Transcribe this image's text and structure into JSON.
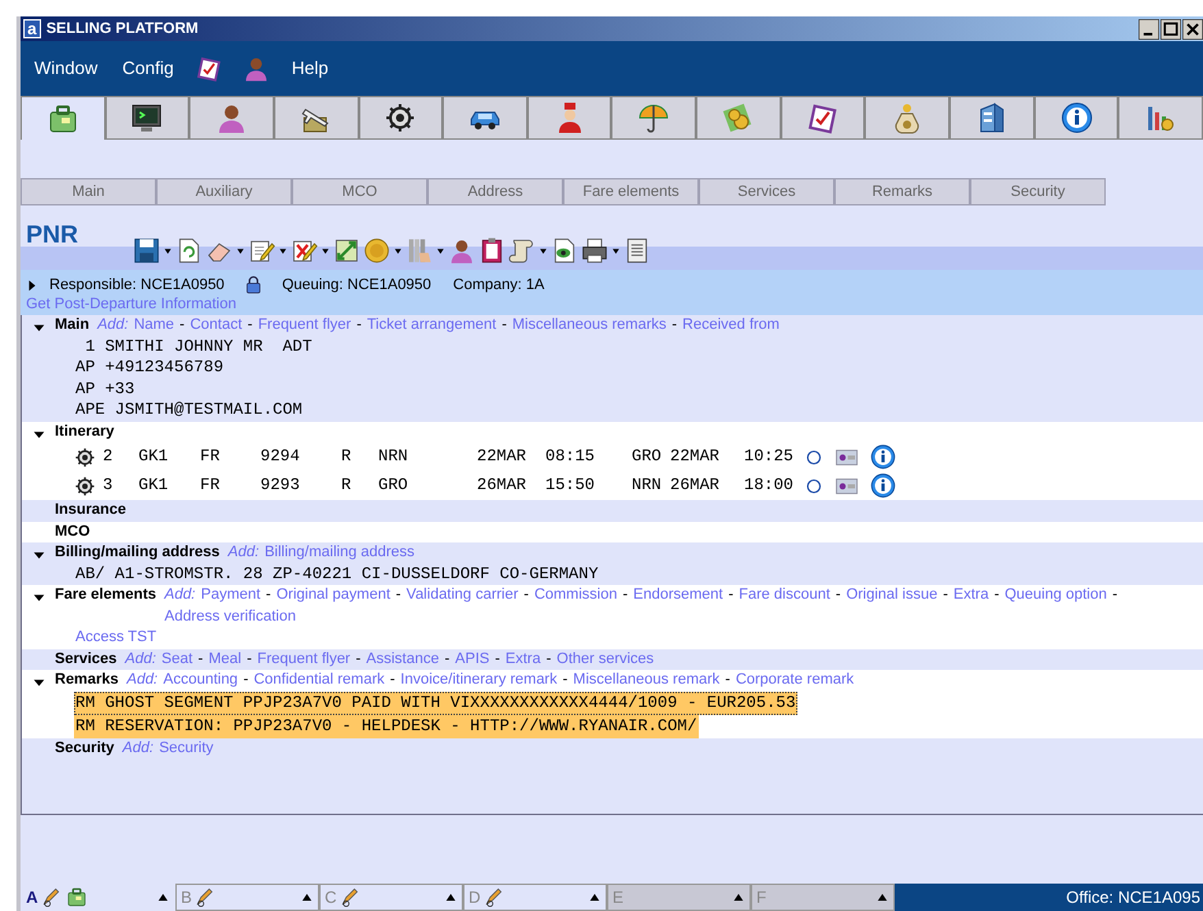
{
  "window": {
    "logo": "a",
    "title": "SELLING PLATFORM"
  },
  "menu": [
    {
      "kind": "text",
      "label": "Window"
    },
    {
      "kind": "text",
      "label": "Config"
    },
    {
      "kind": "icon"
    },
    {
      "kind": "icon"
    },
    {
      "kind": "text",
      "label": "Help"
    }
  ],
  "app_tabs": [
    {
      "selected": true
    },
    {
      "selected": false
    },
    {
      "selected": false
    },
    {
      "selected": false
    },
    {
      "selected": false
    },
    {
      "selected": false
    },
    {
      "selected": false
    },
    {
      "selected": false
    },
    {
      "selected": false
    },
    {
      "selected": false
    },
    {
      "selected": false
    },
    {
      "selected": false
    },
    {
      "selected": false
    },
    {
      "selected": false
    }
  ],
  "sub_tabs": [
    {
      "label": "Main"
    },
    {
      "label": "Auxiliary"
    },
    {
      "label": "MCO"
    },
    {
      "label": "Address"
    },
    {
      "label": "Fare elements"
    },
    {
      "label": "Services"
    },
    {
      "label": "Remarks"
    },
    {
      "label": "Security"
    }
  ],
  "pnr": {
    "title": "PNR"
  },
  "info": {
    "expanded": false,
    "responsible": "Responsible: NCE1A0950",
    "queuing": "Queuing: NCE1A0950",
    "company": "Company: 1A",
    "link": "Get Post-Departure Information"
  },
  "sections": [
    {
      "title": "Main",
      "expanded": true,
      "add_label": "Add:",
      "add": [
        {
          "kind": "link",
          "text": "Name"
        },
        {
          "kind": "separator",
          "text": "-"
        },
        {
          "kind": "link",
          "text": "Contact"
        },
        {
          "kind": "separator",
          "text": "-"
        },
        {
          "kind": "link",
          "text": "Frequent flyer"
        },
        {
          "kind": "separator",
          "text": "-"
        },
        {
          "kind": "link",
          "text": "Ticket arrangement"
        },
        {
          "kind": "separator",
          "text": "-"
        },
        {
          "kind": "link",
          "text": "Miscellaneous remarks"
        },
        {
          "kind": "separator",
          "text": "-"
        },
        {
          "kind": "link",
          "text": "Received from"
        }
      ],
      "lines": [
        " 1 SMITHI JOHNNY MR  ADT",
        "AP +49123456789",
        "AP +33",
        "APE JSMITH@TESTMAIL.COM"
      ]
    },
    {
      "title": "Itinerary",
      "expanded": true,
      "segments": [
        {
          "number": "2",
          "status": "GK1",
          "airline": "FR",
          "flight": "9294",
          "class": "R",
          "origin": "NRN",
          "dep_date": "22MAR",
          "dep_time": "08:15",
          "destination": "GRO",
          "arr_date": "22MAR",
          "arr_time": "10:25"
        },
        {
          "number": "3",
          "status": "GK1",
          "airline": "FR",
          "flight": "9293",
          "class": "R",
          "origin": "GRO",
          "dep_date": "26MAR",
          "dep_time": "15:50",
          "destination": "NRN",
          "arr_date": "26MAR",
          "arr_time": "18:00"
        }
      ]
    },
    {
      "title": "Insurance"
    },
    {
      "title": "MCO"
    },
    {
      "title": "Billing/mailing address",
      "expanded": true,
      "add_label": "Add:",
      "add": [
        {
          "kind": "link",
          "text": "Billing/mailing address"
        }
      ],
      "lines": [
        "AB/ A1-STROMSTR. 28 ZP-40221 CI-DUSSELDORF CO-GERMANY"
      ]
    },
    {
      "title": "Fare elements",
      "expanded": true,
      "add_label": "Add:",
      "add": [
        {
          "kind": "link",
          "text": "Payment"
        },
        {
          "kind": "separator",
          "text": "-"
        },
        {
          "kind": "link",
          "text": "Original payment"
        },
        {
          "kind": "separator",
          "text": "-"
        },
        {
          "kind": "link",
          "text": "Validating carrier"
        },
        {
          "kind": "separator",
          "text": "-"
        },
        {
          "kind": "link",
          "text": "Commission"
        },
        {
          "kind": "separator",
          "text": "-"
        },
        {
          "kind": "link",
          "text": "Endorsement"
        },
        {
          "kind": "separator",
          "text": "-"
        },
        {
          "kind": "link",
          "text": "Fare discount"
        },
        {
          "kind": "separator",
          "text": "-"
        },
        {
          "kind": "link",
          "text": "Original issue"
        },
        {
          "kind": "separator",
          "text": "-"
        },
        {
          "kind": "link",
          "text": "Extra"
        },
        {
          "kind": "separator",
          "text": "-"
        },
        {
          "kind": "link",
          "text": "Queuing option"
        },
        {
          "kind": "separator",
          "text": "-"
        },
        {
          "kind": "link",
          "text": "Address verification"
        }
      ],
      "links": [
        "Access TST"
      ]
    },
    {
      "title": "Services",
      "add_label": "Add:",
      "add": [
        {
          "kind": "link",
          "text": "Seat"
        },
        {
          "kind": "separator",
          "text": "-"
        },
        {
          "kind": "link",
          "text": "Meal"
        },
        {
          "kind": "separator",
          "text": "-"
        },
        {
          "kind": "link",
          "text": "Frequent flyer"
        },
        {
          "kind": "separator",
          "text": "-"
        },
        {
          "kind": "link",
          "text": "Assistance"
        },
        {
          "kind": "separator",
          "text": "-"
        },
        {
          "kind": "link",
          "text": "APIS"
        },
        {
          "kind": "separator",
          "text": "-"
        },
        {
          "kind": "link",
          "text": "Extra"
        },
        {
          "kind": "separator",
          "text": "-"
        },
        {
          "kind": "link",
          "text": "Other services"
        }
      ]
    },
    {
      "title": "Remarks",
      "expanded": true,
      "add_label": "Add:",
      "add": [
        {
          "kind": "link",
          "text": "Accounting"
        },
        {
          "kind": "separator",
          "text": "-"
        },
        {
          "kind": "link",
          "text": "Confidential remark"
        },
        {
          "kind": "separator",
          "text": "-"
        },
        {
          "kind": "link",
          "text": "Invoice/itinerary remark"
        },
        {
          "kind": "separator",
          "text": "-"
        },
        {
          "kind": "link",
          "text": "Miscellaneous remark"
        },
        {
          "kind": "separator",
          "text": "-"
        },
        {
          "kind": "link",
          "text": "Corporate remark"
        }
      ],
      "remarks": [
        {
          "text": "RM GHOST SEGMENT PPJP23A7V0 PAID WITH VIXXXXXXXXXXXX4444/1009 - EUR205.53",
          "selected": true,
          "focused": true
        },
        {
          "text": "RM RESERVATION: PPJP23A7V0 - HELPDESK - HTTP://WWW.RYANAIR.COM/",
          "selected": true,
          "focused": false
        }
      ]
    },
    {
      "title": "Security",
      "add_label": "Add:",
      "add": [
        {
          "kind": "link",
          "text": "Security"
        }
      ]
    }
  ],
  "workspaces": [
    {
      "label": "A",
      "selected": true,
      "disabled": false
    },
    {
      "label": "B",
      "selected": false,
      "disabled": false
    },
    {
      "label": "C",
      "selected": false,
      "disabled": false
    },
    {
      "label": "D",
      "selected": false,
      "disabled": false
    },
    {
      "label": "E",
      "selected": false,
      "disabled": true
    },
    {
      "label": "F",
      "selected": false,
      "disabled": true
    }
  ],
  "status_bar": {
    "office": "Office: NCE1A095"
  }
}
